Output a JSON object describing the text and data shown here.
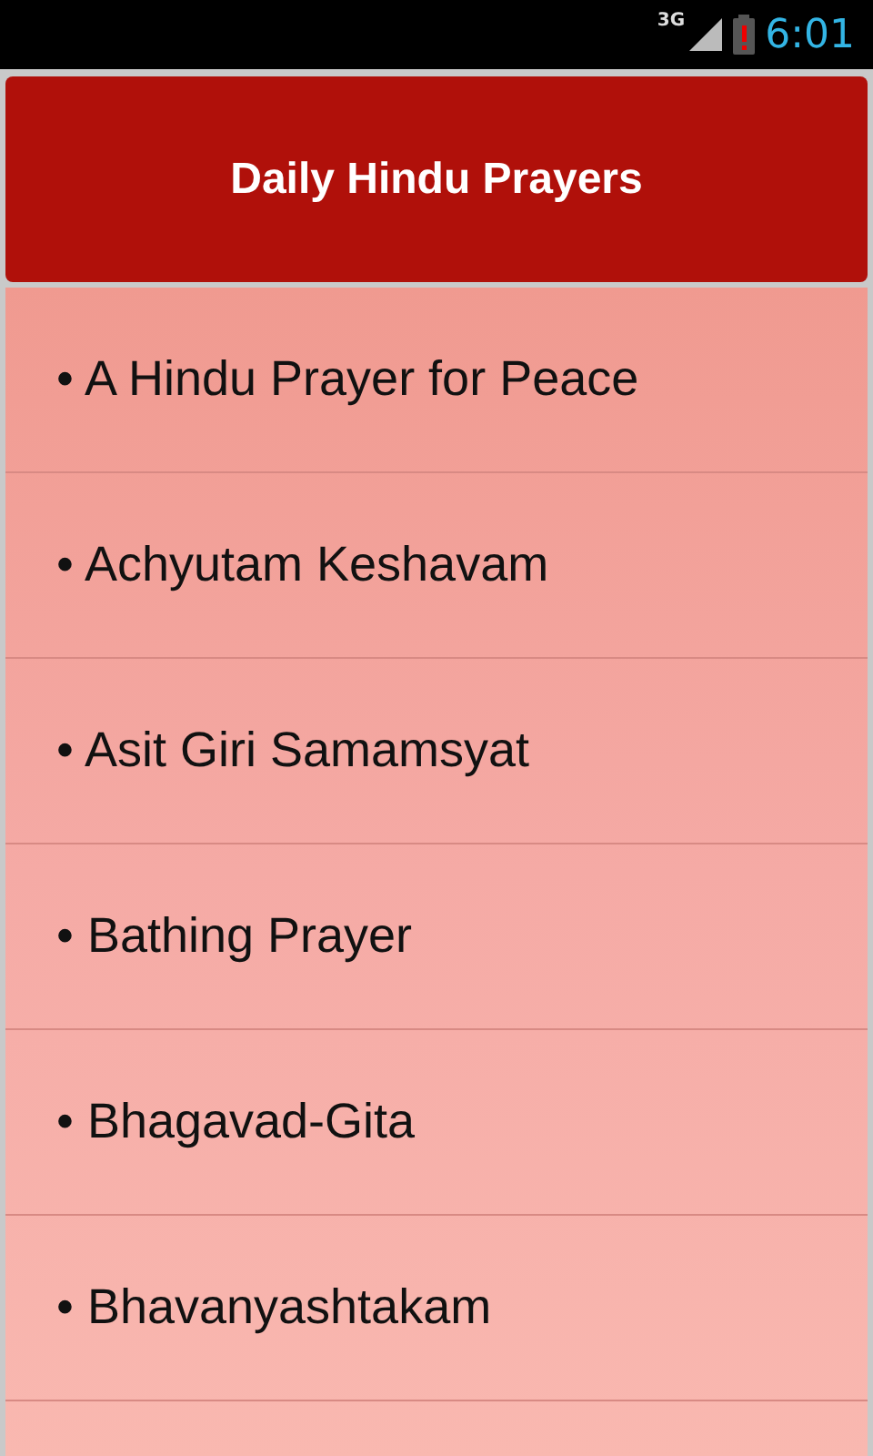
{
  "status_bar": {
    "network": "3G",
    "time": "6:01"
  },
  "header": {
    "title": "Daily Hindu Prayers"
  },
  "prayers": [
    {
      "label": "• A Hindu Prayer for Peace"
    },
    {
      "label": "• Achyutam Keshavam"
    },
    {
      "label": "• Asit Giri Samamsyat"
    },
    {
      "label": "• Bathing Prayer"
    },
    {
      "label": "• Bhagavad-Gita"
    },
    {
      "label": "• Bhavanyashtakam"
    }
  ]
}
